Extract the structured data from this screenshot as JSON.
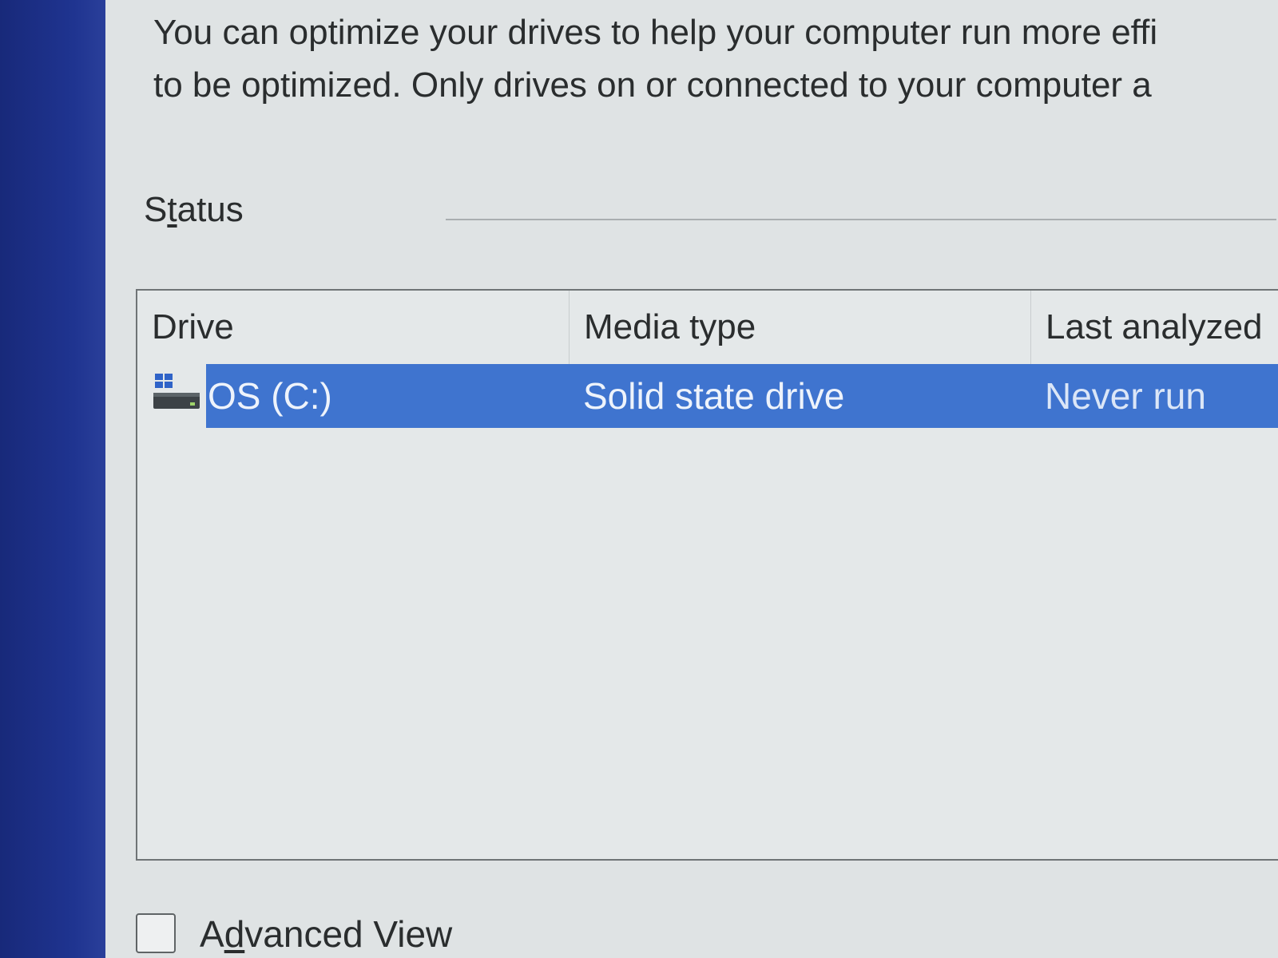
{
  "description": {
    "line1": "You can optimize your drives to help your computer run more effi",
    "line2": "to be optimized. Only drives on or connected to your computer a"
  },
  "status": {
    "label_before": "S",
    "label_accel": "t",
    "label_after": "atus"
  },
  "drive_list": {
    "columns": {
      "drive": "Drive",
      "media_type": "Media type",
      "last_analyzed": "Last analyzed"
    },
    "rows": [
      {
        "drive": "OS (C:)",
        "media_type": "Solid state drive",
        "last_analyzed": "Never run",
        "icon": "windows-drive-icon",
        "selected": true
      }
    ]
  },
  "advanced_view": {
    "label_before": "A",
    "label_accel": "d",
    "label_after": "vanced View",
    "checked": false
  },
  "colors": {
    "selection": "#3f74cf",
    "window_bg": "#dfe3e4",
    "desktop_strip": "#1d2f86",
    "text": "#2a2d2e"
  }
}
